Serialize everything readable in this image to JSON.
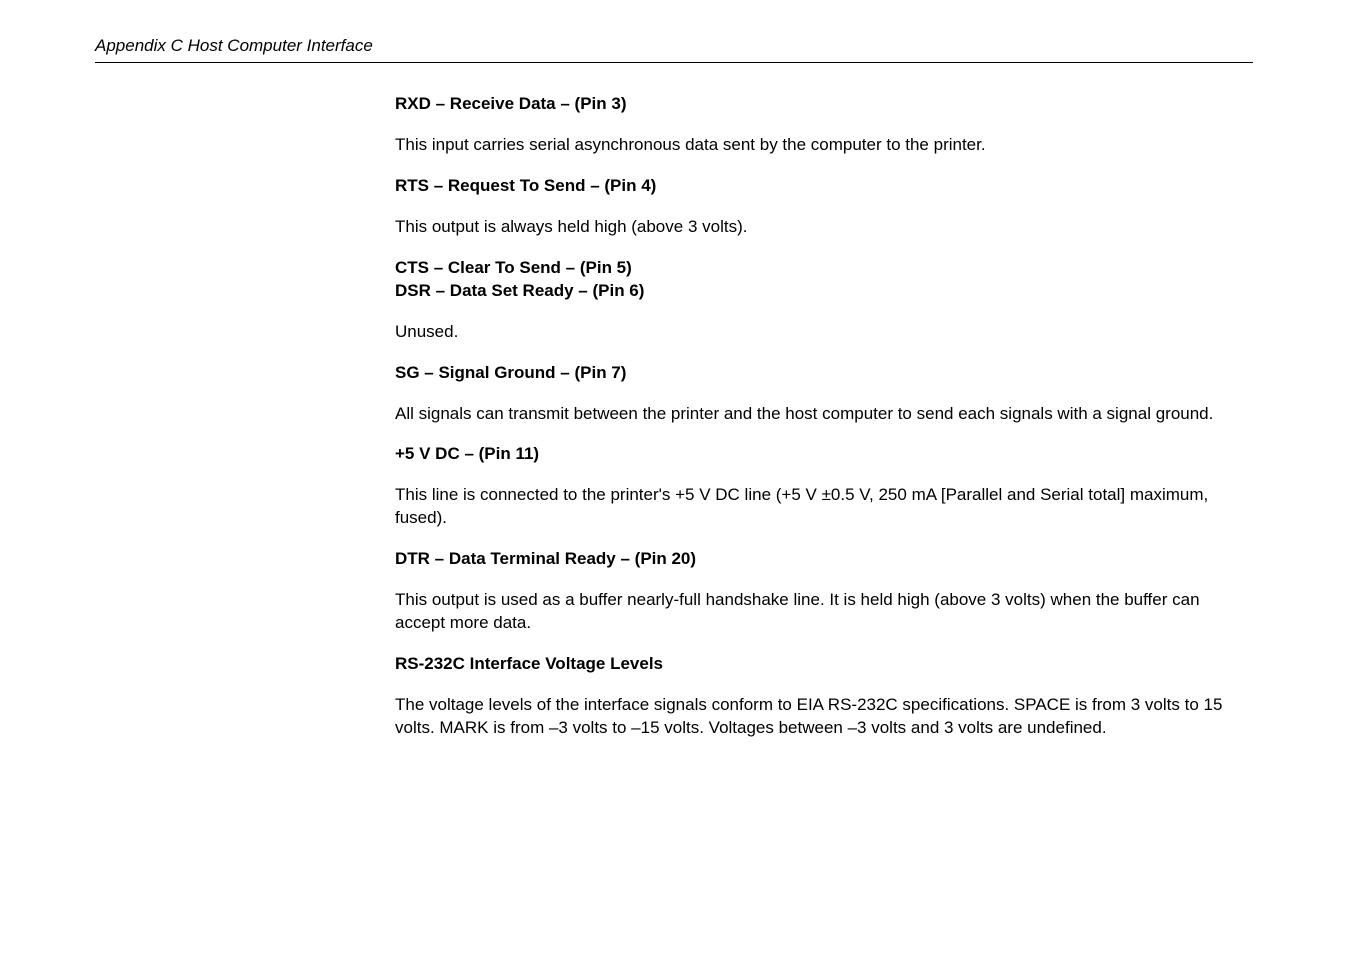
{
  "header": "Appendix C  Host Computer Interface",
  "sections": {
    "rxd": {
      "heading": "RXD – Receive Data – (Pin 3)",
      "body": "This input carries serial asynchronous data sent by the computer to the printer."
    },
    "rts": {
      "heading": "RTS – Request To Send – (Pin 4)",
      "body": "This output is always held high (above 3 volts)."
    },
    "cts": {
      "heading1": "CTS – Clear To Send – (Pin 5)",
      "heading2": "DSR – Data Set Ready – (Pin 6)",
      "body": "Unused."
    },
    "sg": {
      "heading": "SG – Signal Ground – (Pin 7)",
      "body": "All signals can transmit between the printer and the host computer to send each signals with a signal ground."
    },
    "v5": {
      "heading": "+5 V DC – (Pin 11)",
      "body": "This line is connected to the printer's +5 V DC line (+5 V ±0.5 V, 250 mA [Parallel and Serial total] maximum, fused)."
    },
    "dtr": {
      "heading": "DTR – Data Terminal Ready – (Pin 20)",
      "body": "This output is used as a buffer nearly-full handshake line. It is held high (above 3 volts) when the buffer can accept more data."
    },
    "rs232": {
      "heading": "RS-232C Interface Voltage Levels",
      "body": "The voltage levels of the interface signals conform to EIA RS-232C specifications. SPACE is from 3 volts to 15 volts. MARK is from –3 volts to –15 volts. Voltages between –3 volts and 3 volts are undefined."
    }
  }
}
